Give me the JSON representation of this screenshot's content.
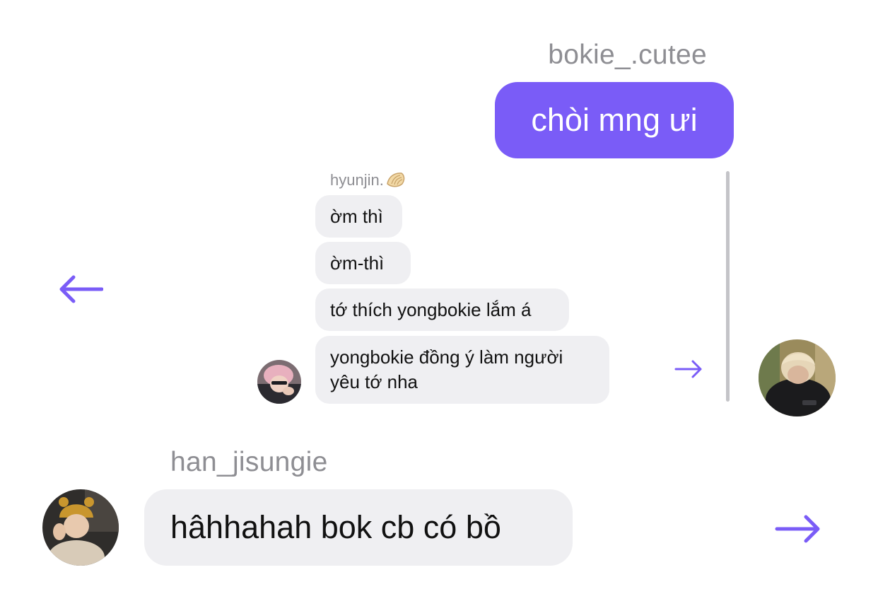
{
  "top_message": {
    "sender": "bokie_.cutee",
    "text": "chòi mng ưi"
  },
  "quoted_thread": {
    "author": "hyunjin.",
    "author_icon": "dumpling-emoji-icon",
    "messages": [
      "ờm thì",
      "ờm-thì",
      "tớ thích yongbokie lắm á",
      "yongbokie đồng ý làm người yêu tớ nha"
    ]
  },
  "bottom_message": {
    "sender": "han_jisungie",
    "text": "hâhhahah bok cb có bồ"
  },
  "colors": {
    "accent": "#7a5cf7",
    "incoming_bubble": "#efeff2",
    "sender_label": "#8e8e93"
  },
  "icons": {
    "left_arrow": "arrow-left-icon",
    "small_right_arrow": "arrow-right-icon",
    "large_right_arrow": "arrow-right-icon"
  }
}
